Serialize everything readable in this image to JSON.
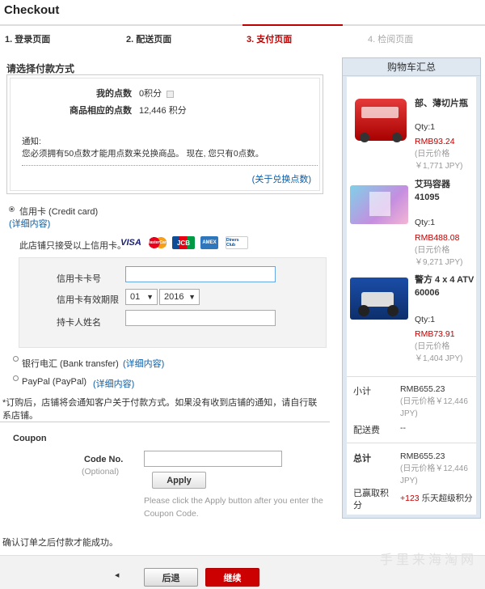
{
  "page": {
    "title": "Checkout"
  },
  "steps": [
    {
      "label": "1. 登录页面"
    },
    {
      "label": "2. 配送页面"
    },
    {
      "label": "3. 支付页面"
    },
    {
      "label": "4. 检阅页面"
    }
  ],
  "payment": {
    "section_title": "请选择付款方式",
    "my_points_label": "我的点数",
    "my_points_value": "0积分",
    "goods_points_label": "商品相应的点数",
    "goods_points_value": "12,446 积分",
    "notice_title": "通知:",
    "notice_text": "您必须拥有50点数才能用点数来兑换商品。 现在, 您只有0点数。",
    "about_link": "(关于兑换点数)",
    "credit_card_label": "信用卡 (Credit card)",
    "credit_card_details": "(详细内容)",
    "accepted_cards_label": "此店铺只接受以上信用卡。",
    "card_logos": [
      "VISA",
      "MasterCard",
      "JCB",
      "AMEX",
      "Diners Club"
    ],
    "card_number_label": "信用卡卡号",
    "card_expiry_label": "信用卡有效期限",
    "expiry_month": "01",
    "expiry_year": "2016",
    "card_holder_label": "持卡人姓名",
    "bank_label": "银行电汇 (Bank transfer)",
    "bank_details": "(详细内容)",
    "paypal_label": "PayPal (PayPal)",
    "paypal_details": "(详细内容)",
    "footnote": "*订购后，店铺将会通知客户关于付款方式。如果没有收到店铺的通知，请自行联系店铺。"
  },
  "coupon": {
    "title": "Coupon",
    "code_label": "Code No.",
    "optional_label": "(Optional)",
    "apply_label": "Apply",
    "help_text": "Please click the Apply button after you enter the Coupon Code."
  },
  "footer": {
    "confirm_text": "确认订单之后付款才能成功。",
    "back_label": "后退",
    "next_label": "继续",
    "watermark": "手里来海淘网"
  },
  "cart": {
    "title": "购物车汇总",
    "items": [
      {
        "name": "部、薄切片瓶",
        "qty": "Qty:1",
        "price": "RMB93.24",
        "yen": "(日元价格￥1,771 JPY)"
      },
      {
        "name": "艾玛容器 41095",
        "qty": "Qty:1",
        "price": "RMB488.08",
        "yen": "(日元价格￥9,271 JPY)"
      },
      {
        "name": "警方 4 x 4 ATV 60006",
        "qty": "Qty:1",
        "price": "RMB73.91",
        "yen": "(日元价格￥1,404 JPY)"
      }
    ],
    "subtotal_label": "小计",
    "subtotal_value": "RMB655.23",
    "subtotal_yen": "(日元价格￥12,446 JPY)",
    "shipping_label": "配送费",
    "shipping_value": "--",
    "total_label": "总计",
    "total_value": "RMB655.23",
    "total_yen": "(日元价格￥12,446 JPY)",
    "earned_label": "已赢取积分",
    "earned_value": "+123",
    "earned_unit": "乐天超级积分"
  },
  "colors": {
    "accent": "#bf0000",
    "link": "#0a5ea8"
  }
}
